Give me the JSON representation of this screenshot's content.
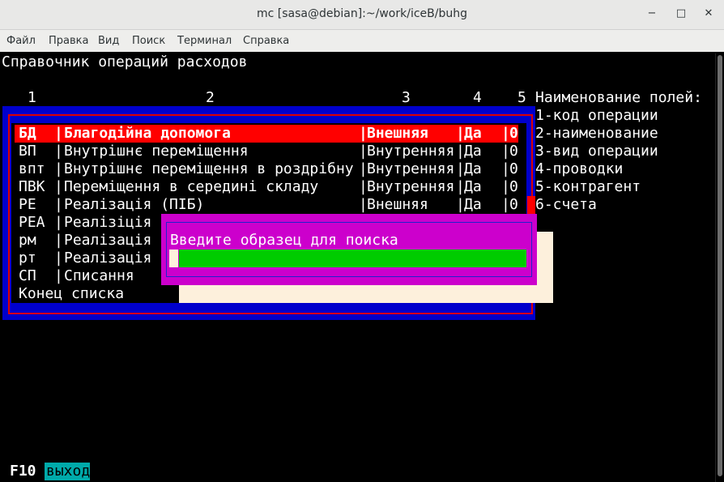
{
  "window": {
    "title": "mc [sasa@debian]:~/work/iceB/buhg",
    "minimize_icon": "minimize-icon",
    "maximize_icon": "maximize-icon",
    "close_icon": "close-icon",
    "min_glyph": "−",
    "max_glyph": "□",
    "close_glyph": "✕"
  },
  "menu": [
    "Файл",
    "Правка",
    "Вид",
    "Поиск",
    "Терминал",
    "Справка"
  ],
  "screen": {
    "heading": "Справочник операций расходов",
    "col_numbers": [
      "1",
      "2",
      "3",
      "4",
      "5"
    ],
    "fields_header": "Наименование полей:",
    "fields": [
      "1-код операции",
      "2-наименование",
      "3-вид операции",
      "4-проводки",
      "5-контрагент",
      "6-счета"
    ],
    "rows": [
      {
        "code": "БД",
        "name": "Благодійна допомога",
        "type": "Внешняя",
        "prov": "Да",
        "kontr": "0"
      },
      {
        "code": "ВП",
        "name": "Внутрішнє переміщення",
        "type": "Внутренняя",
        "prov": "Да",
        "kontr": "0"
      },
      {
        "code": "впт",
        "name": "Внутрішнє переміщення в роздрібну",
        "type": "Внутренняя",
        "prov": "Да",
        "kontr": "0"
      },
      {
        "code": "ПВК",
        "name": "Переміщення в середині складу",
        "type": "Внутренняя",
        "prov": "Да",
        "kontr": "0"
      },
      {
        "code": "РЕ",
        "name": "Реалізація (ПІБ)",
        "type": "Внешняя",
        "prov": "Да",
        "kontr": "0"
      },
      {
        "code": "РЕА",
        "name": "Реалізіція"
      },
      {
        "code": "рм",
        "name": "Реалізація"
      },
      {
        "code": "рт",
        "name": "Реалізація"
      },
      {
        "code": "СП",
        "name": "Списання"
      }
    ],
    "end_of_list": "Конец списка",
    "sep": "|",
    "search_prompt": "Введите образец для поиска",
    "search_value": "",
    "f10_key": "F10",
    "f10_label": "выход"
  },
  "colors": {
    "frame": "#0000cc",
    "highlight": "#ff0000",
    "dialog": "#cc00cc",
    "input": "#00cc00",
    "key_label": "#00aaaa"
  }
}
